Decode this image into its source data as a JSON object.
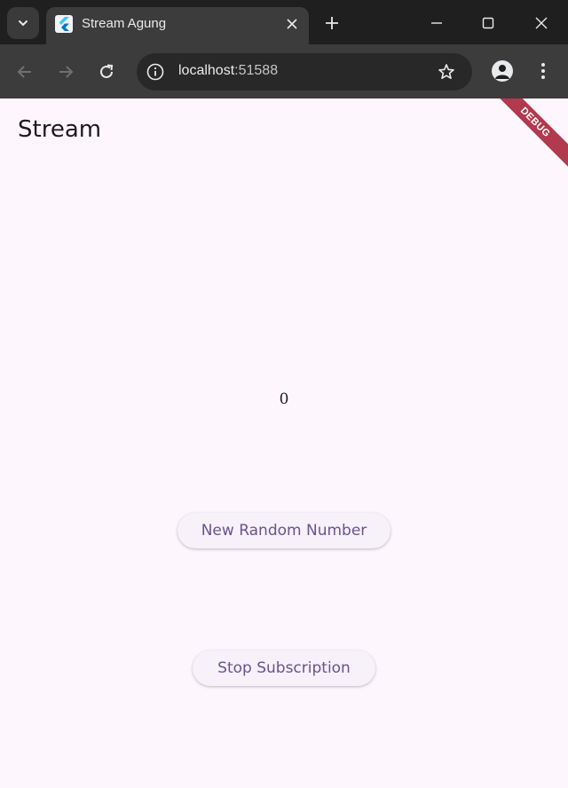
{
  "browser": {
    "tab_title": "Stream Agung",
    "url_host": "localhost",
    "url_port": ":51588"
  },
  "app": {
    "title": "Stream",
    "counter_value": "0",
    "new_random_label": "New Random Number",
    "stop_subscription_label": "Stop Subscription",
    "debug_label": "DEBUG"
  },
  "colors": {
    "accent": "#65558f",
    "background": "#fdf7fd",
    "debug_banner": "#b13a4e"
  }
}
